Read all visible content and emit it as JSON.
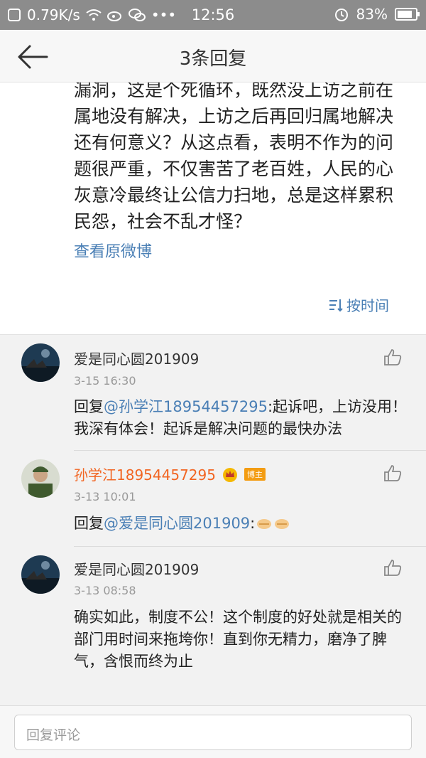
{
  "status_bar": {
    "speed": "0.79K/s",
    "time": "12:56",
    "battery": "83%",
    "battery_level": 0.83
  },
  "header": {
    "title": "3条回复"
  },
  "post": {
    "text": "漏洞，这是个死循环，既然没上访之前在属地没有解决，上访之后再回归属地解决还有何意义？从这点看，表明不作为的问题很严重，不仅害苦了老百姓，人民的心灰意冷最终让公信力扫地，总是这样累积民怨，社会不乱才怪？",
    "view_original": "查看原微博",
    "sort_label": "按时间"
  },
  "replies": [
    {
      "name": "爱是同心圆201909",
      "time": "3-15 16:30",
      "prefix": "回复",
      "mention": "@孙学江18954457295",
      "text": ":起诉吧，上访没用！我深有体会！起诉是解决问题的最快办法"
    },
    {
      "name": "孙学江18954457295",
      "badge": "博主",
      "time": "3-13 10:01",
      "prefix": "回复",
      "mention": "@爱是同心圆201909",
      "text": ":"
    },
    {
      "name": "爱是同心圆201909",
      "time": "3-13 08:58",
      "text": "确实如此，制度不公！这个制度的好处就是相关的部门用时间来拖垮你！直到你无精力，磨净了脾气，含恨而终为止"
    }
  ],
  "input": {
    "placeholder": "回复评论"
  }
}
